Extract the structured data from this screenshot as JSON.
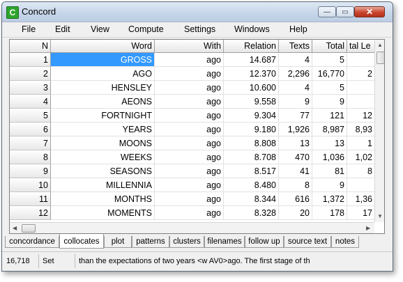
{
  "window": {
    "title": "Concord",
    "icon_letter": "C",
    "min_glyph": "—",
    "max_glyph": "▭",
    "close_glyph": "✕"
  },
  "menu": [
    "File",
    "Edit",
    "View",
    "Compute",
    "Settings",
    "Windows",
    "Help"
  ],
  "columns": [
    "N",
    "Word",
    "With",
    "Relation",
    "Texts",
    "Total",
    "tal Le"
  ],
  "rows": [
    {
      "n": "1",
      "word": "GROSS",
      "with": "ago",
      "relation": "14.687",
      "texts": "4",
      "total": "5",
      "tal_le": ""
    },
    {
      "n": "2",
      "word": "AGO",
      "with": "ago",
      "relation": "12.370",
      "texts": "2,296",
      "total": "16,770",
      "tal_le": "2"
    },
    {
      "n": "3",
      "word": "HENSLEY",
      "with": "ago",
      "relation": "10.600",
      "texts": "4",
      "total": "5",
      "tal_le": ""
    },
    {
      "n": "4",
      "word": "AEONS",
      "with": "ago",
      "relation": "9.558",
      "texts": "9",
      "total": "9",
      "tal_le": ""
    },
    {
      "n": "5",
      "word": "FORTNIGHT",
      "with": "ago",
      "relation": "9.304",
      "texts": "77",
      "total": "121",
      "tal_le": "12"
    },
    {
      "n": "6",
      "word": "YEARS",
      "with": "ago",
      "relation": "9.180",
      "texts": "1,926",
      "total": "8,987",
      "tal_le": "8,93"
    },
    {
      "n": "7",
      "word": "MOONS",
      "with": "ago",
      "relation": "8.808",
      "texts": "13",
      "total": "13",
      "tal_le": "1"
    },
    {
      "n": "8",
      "word": "WEEKS",
      "with": "ago",
      "relation": "8.708",
      "texts": "470",
      "total": "1,036",
      "tal_le": "1,02"
    },
    {
      "n": "9",
      "word": "SEASONS",
      "with": "ago",
      "relation": "8.517",
      "texts": "41",
      "total": "81",
      "tal_le": "8"
    },
    {
      "n": "10",
      "word": "MILLENNIA",
      "with": "ago",
      "relation": "8.480",
      "texts": "8",
      "total": "9",
      "tal_le": ""
    },
    {
      "n": "11",
      "word": "MONTHS",
      "with": "ago",
      "relation": "8.344",
      "texts": "616",
      "total": "1,372",
      "tal_le": "1,36"
    },
    {
      "n": "12",
      "word": "MOMENTS",
      "with": "ago",
      "relation": "8.328",
      "texts": "20",
      "total": "178",
      "tal_le": "17"
    }
  ],
  "tabs": [
    "concordance",
    "collocates",
    "plot",
    "patterns",
    "clusters",
    "filenames",
    "follow up",
    "source text",
    "notes"
  ],
  "active_tab": "collocates",
  "status": {
    "count": "16,718",
    "mode": "Set",
    "context": "than the expectations of two years <w AV0>ago. The first stage of th"
  }
}
